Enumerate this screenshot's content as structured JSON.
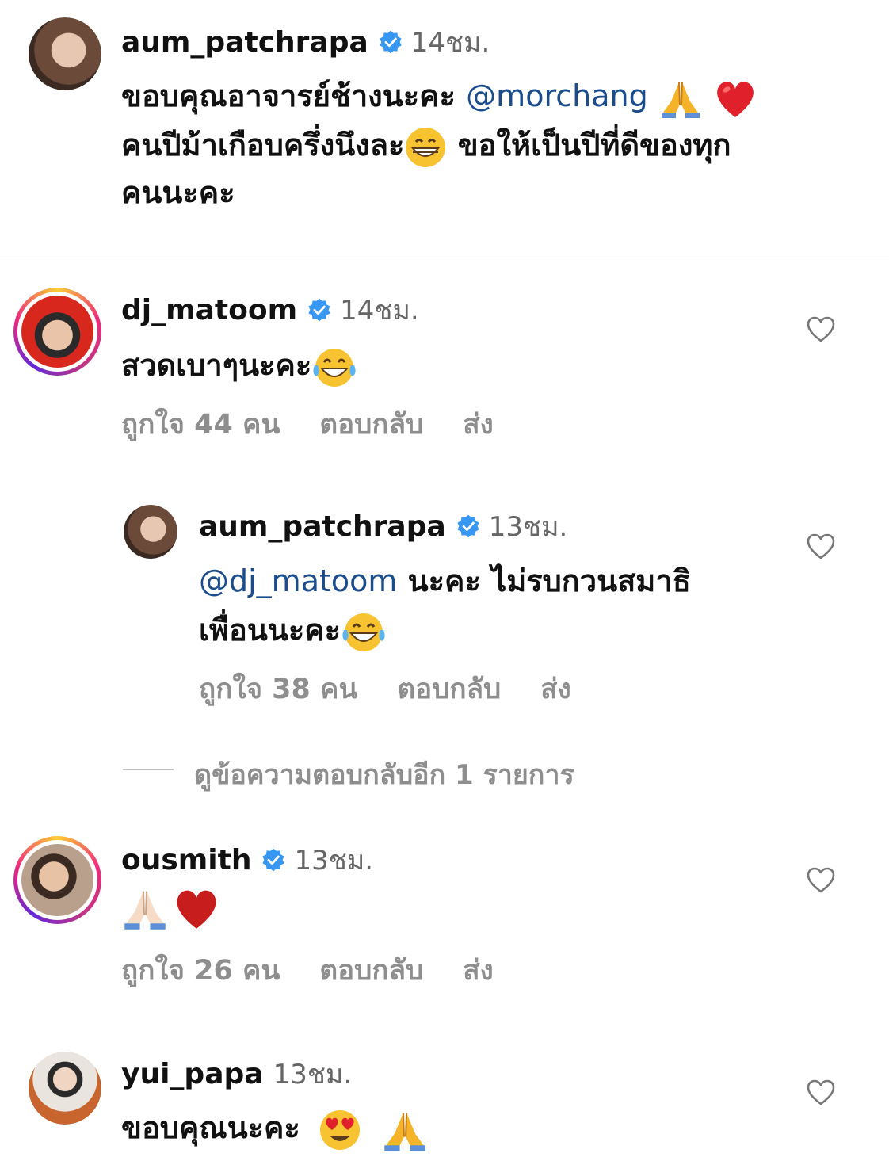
{
  "colors": {
    "mention": "#1b4d8c",
    "meta": "#8e8e8e",
    "verified": "#3897f0",
    "heart_outline": "#777777"
  },
  "comments": [
    {
      "username": "aum_patchrapa",
      "verified": true,
      "time": "14ชม.",
      "line1": "ขอบคุณอาจารย์ช้างนะคะ",
      "mention": "@morchang",
      "line2": "คนปีม้าเกือบครึ่งนึงละ",
      "line2b": "ขอให้เป็นปีที่ดีของทุก",
      "line3": "คนนะคะ"
    },
    {
      "username": "dj_matoom",
      "verified": true,
      "time": "14ชม.",
      "text": "สวดเบาๆนะคะ",
      "likes": "ถูกใจ 44 คน",
      "reply": "ตอบกลับ",
      "send": "ส่ง"
    },
    {
      "username": "aum_patchrapa",
      "verified": true,
      "time": "13ชม.",
      "mention": "@dj_matoom",
      "line1": "นะคะ ไม่รบกวนสมาธิ",
      "line2": "เพื่อนนะคะ",
      "likes": "ถูกใจ 38 คน",
      "reply": "ตอบกลับ",
      "send": "ส่ง"
    },
    {
      "username": "ousmith",
      "verified": true,
      "time": "13ชม.",
      "likes": "ถูกใจ 26 คน",
      "reply": "ตอบกลับ",
      "send": "ส่ง"
    },
    {
      "username": "yui_papa",
      "verified": false,
      "time": "13ชม.",
      "text": "ขอบคุณนะคะ"
    }
  ],
  "view_more_replies": "ดูข้อความตอบกลับอีก 1 รายการ",
  "icons": [
    "verified-badge-icon",
    "heart-outline-icon",
    "emoji-folded-hands",
    "emoji-red-heart",
    "emoji-grinning",
    "emoji-tears-of-joy",
    "emoji-heart-eyes"
  ]
}
